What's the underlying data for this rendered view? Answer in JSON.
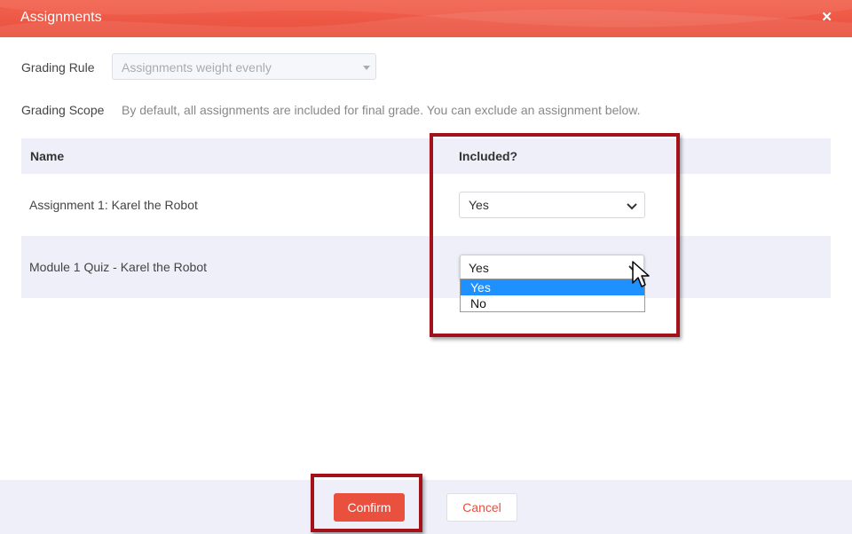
{
  "dialog": {
    "title": "Assignments",
    "close_glyph": "✕"
  },
  "grading_rule": {
    "label": "Grading Rule",
    "value": "Assignments weight evenly"
  },
  "grading_scope": {
    "label": "Grading Scope",
    "text": "By default, all assignments are included for final grade. You can exclude an assignment below."
  },
  "table": {
    "headers": {
      "name": "Name",
      "included": "Included?"
    },
    "rows": [
      {
        "name": "Assignment 1: Karel the Robot",
        "included": "Yes"
      },
      {
        "name": "Module 1 Quiz - Karel the Robot",
        "included": "Yes"
      }
    ]
  },
  "dropdown": {
    "options": [
      "Yes",
      "No"
    ],
    "selected": "Yes"
  },
  "footer": {
    "confirm_label": "Confirm",
    "cancel_label": "Cancel"
  },
  "colors": {
    "accent": "#e9503e",
    "highlight": "#a3111b",
    "table_stripe": "#eeeff8",
    "selected_option": "#1e90ff"
  }
}
